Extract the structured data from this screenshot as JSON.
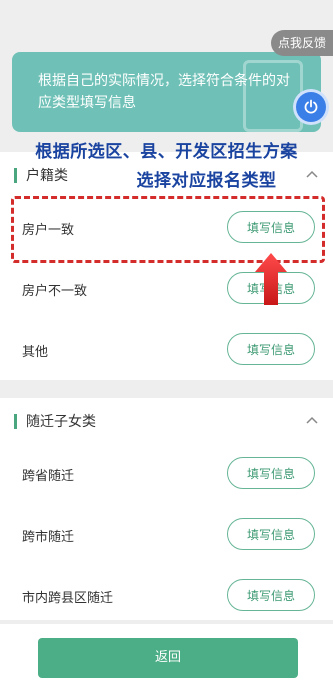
{
  "feedback_label": "点我反馈",
  "banner": {
    "text": "根据自己的实际情况，选择符合条件的对应类型填写信息"
  },
  "overlay": {
    "line1": "根据所选区、县、开发区招生方案",
    "line2": "选择对应报名类型"
  },
  "sections": [
    {
      "title": "户籍类",
      "rows": [
        {
          "label": "房户一致",
          "button": "填写信息"
        },
        {
          "label": "房户不一致",
          "button": "填写信息"
        },
        {
          "label": "其他",
          "button": "填写信息"
        }
      ]
    },
    {
      "title": "随迁子女类",
      "rows": [
        {
          "label": "跨省随迁",
          "button": "填写信息"
        },
        {
          "label": "跨市随迁",
          "button": "填写信息"
        },
        {
          "label": "市内跨县区随迁",
          "button": "填写信息"
        }
      ]
    }
  ],
  "back_label": "返回",
  "colors": {
    "accent": "#4bae86",
    "banner": "#6fc1b7",
    "annotation_red": "#d42b2b",
    "annotation_blue": "#1a44a0"
  },
  "icons": [
    "power-icon",
    "chevron-up-icon",
    "up-arrow-icon"
  ]
}
